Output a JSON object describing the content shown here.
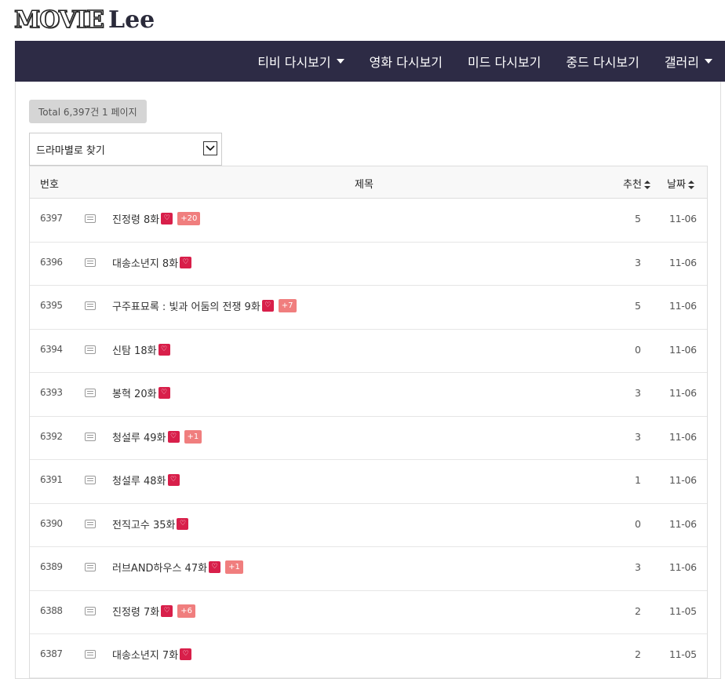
{
  "logo": {
    "movie": "MOVIE",
    "lee": "Lee"
  },
  "nav": [
    {
      "label": "티비 다시보기",
      "dropdown": true
    },
    {
      "label": "영화 다시보기",
      "dropdown": false
    },
    {
      "label": "미드 다시보기",
      "dropdown": false
    },
    {
      "label": "중드 다시보기",
      "dropdown": false
    },
    {
      "label": "갤러리",
      "dropdown": true
    }
  ],
  "total_badge": "Total 6,397건 1 페이지",
  "select": {
    "value": "드라마별로 찾기"
  },
  "table": {
    "headers": {
      "num": "번호",
      "title": "제목",
      "recommend": "추천",
      "date": "날짜"
    },
    "rows": [
      {
        "num": "6397",
        "title": "진정령 8화",
        "comments": "+20",
        "rec": "5",
        "date": "11-06"
      },
      {
        "num": "6396",
        "title": "대송소년지 8화",
        "comments": "",
        "rec": "3",
        "date": "11-06"
      },
      {
        "num": "6395",
        "title": "구주표묘록 : 빛과 어둠의 전쟁 9화",
        "comments": "+7",
        "rec": "5",
        "date": "11-06"
      },
      {
        "num": "6394",
        "title": "신탐 18화",
        "comments": "",
        "rec": "0",
        "date": "11-06"
      },
      {
        "num": "6393",
        "title": "봉혁 20화",
        "comments": "",
        "rec": "3",
        "date": "11-06"
      },
      {
        "num": "6392",
        "title": "청설루 49화",
        "comments": "+1",
        "rec": "3",
        "date": "11-06"
      },
      {
        "num": "6391",
        "title": "청설루 48화",
        "comments": "",
        "rec": "1",
        "date": "11-06"
      },
      {
        "num": "6390",
        "title": "전직고수 35화",
        "comments": "",
        "rec": "0",
        "date": "11-06"
      },
      {
        "num": "6389",
        "title": "러브AND하우스 47화",
        "comments": "+1",
        "rec": "3",
        "date": "11-06"
      },
      {
        "num": "6388",
        "title": "진정령 7화",
        "comments": "+6",
        "rec": "2",
        "date": "11-05"
      },
      {
        "num": "6387",
        "title": "대송소년지 7화",
        "comments": "",
        "rec": "2",
        "date": "11-05"
      }
    ]
  }
}
